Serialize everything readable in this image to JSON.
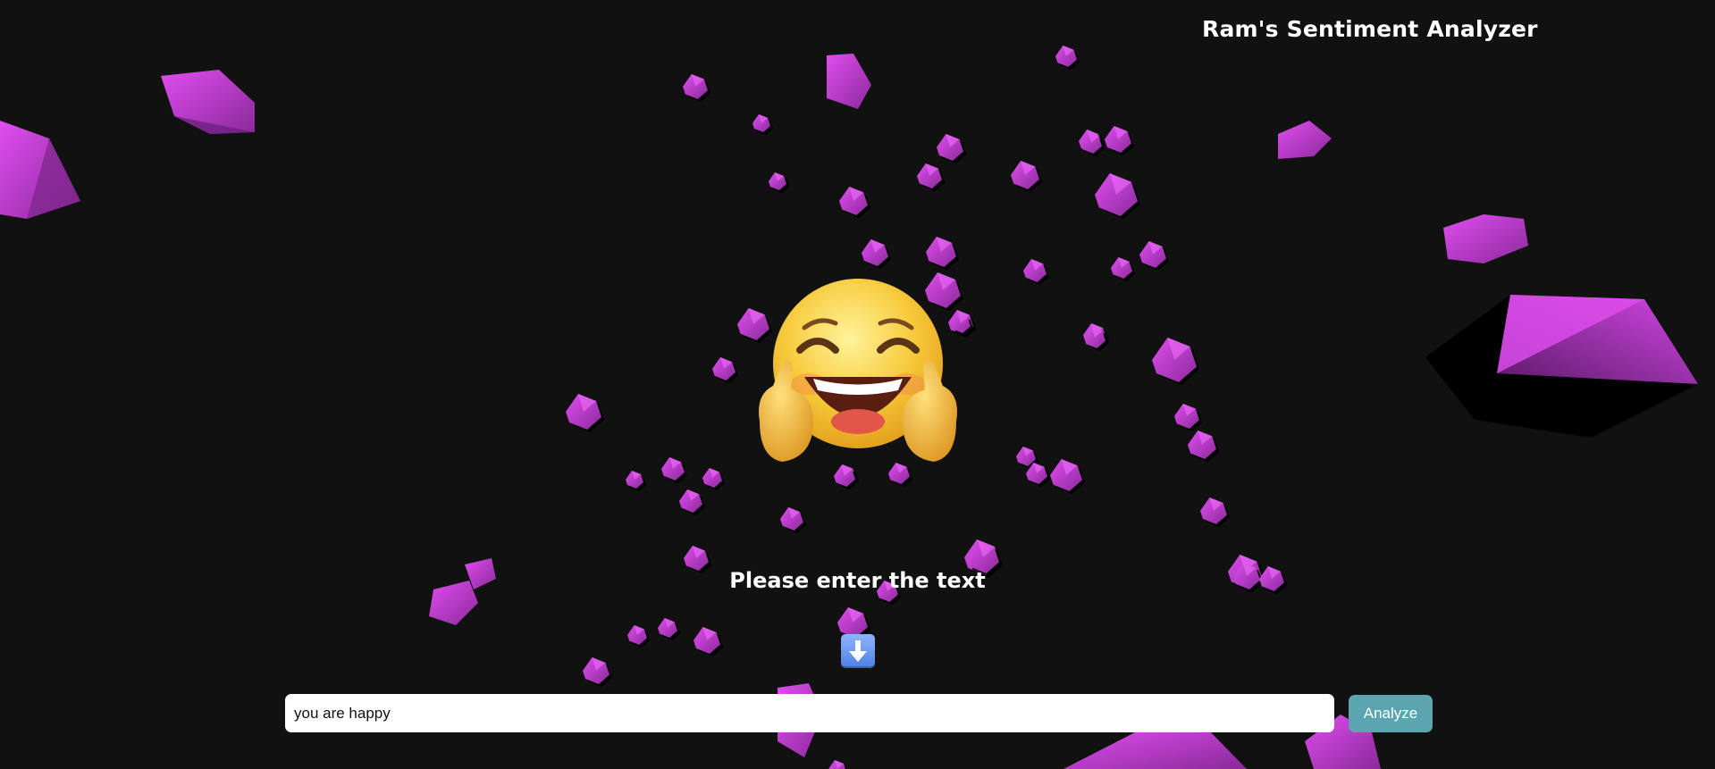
{
  "header": {
    "title": "Ram's Sentiment Analyzer"
  },
  "result": {
    "emoji": "grinning-face-thumbs-up"
  },
  "main": {
    "prompt": "Please enter the text",
    "arrow_icon": "down-arrow-icon"
  },
  "form": {
    "input_value": "you are happy",
    "button_label": "Analyze"
  },
  "colors": {
    "background": "#111111",
    "gem": "#c63fd9",
    "button": "#5aa5b0"
  }
}
